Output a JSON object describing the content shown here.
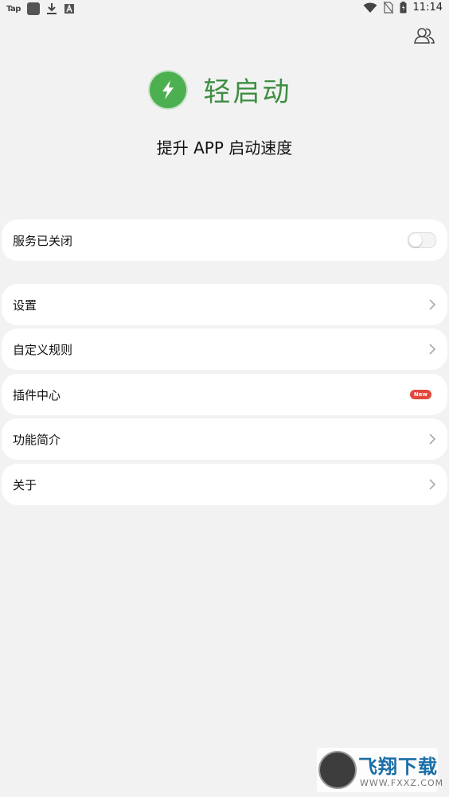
{
  "status_bar": {
    "tap_label": "Tap",
    "time": "11:14"
  },
  "header": {
    "app_name": "轻启动",
    "subtitle": "提升 APP 启动速度"
  },
  "service": {
    "label": "服务已关闭",
    "enabled": false
  },
  "menu": {
    "items": [
      {
        "label": "设置"
      },
      {
        "label": "自定义规则"
      },
      {
        "label": "插件中心",
        "badge": "New"
      },
      {
        "label": "功能简介"
      },
      {
        "label": "关于"
      }
    ]
  },
  "watermark": {
    "brand": "飞翔下载",
    "url": "WWW.FXXZ.COM"
  },
  "colors": {
    "accent": "#4caf50",
    "title_green": "#3e8e41",
    "badge_red": "#e2473c",
    "background": "#f2f2f2"
  },
  "icons": {
    "top_right": "users-icon",
    "logo": "lightning-icon"
  }
}
